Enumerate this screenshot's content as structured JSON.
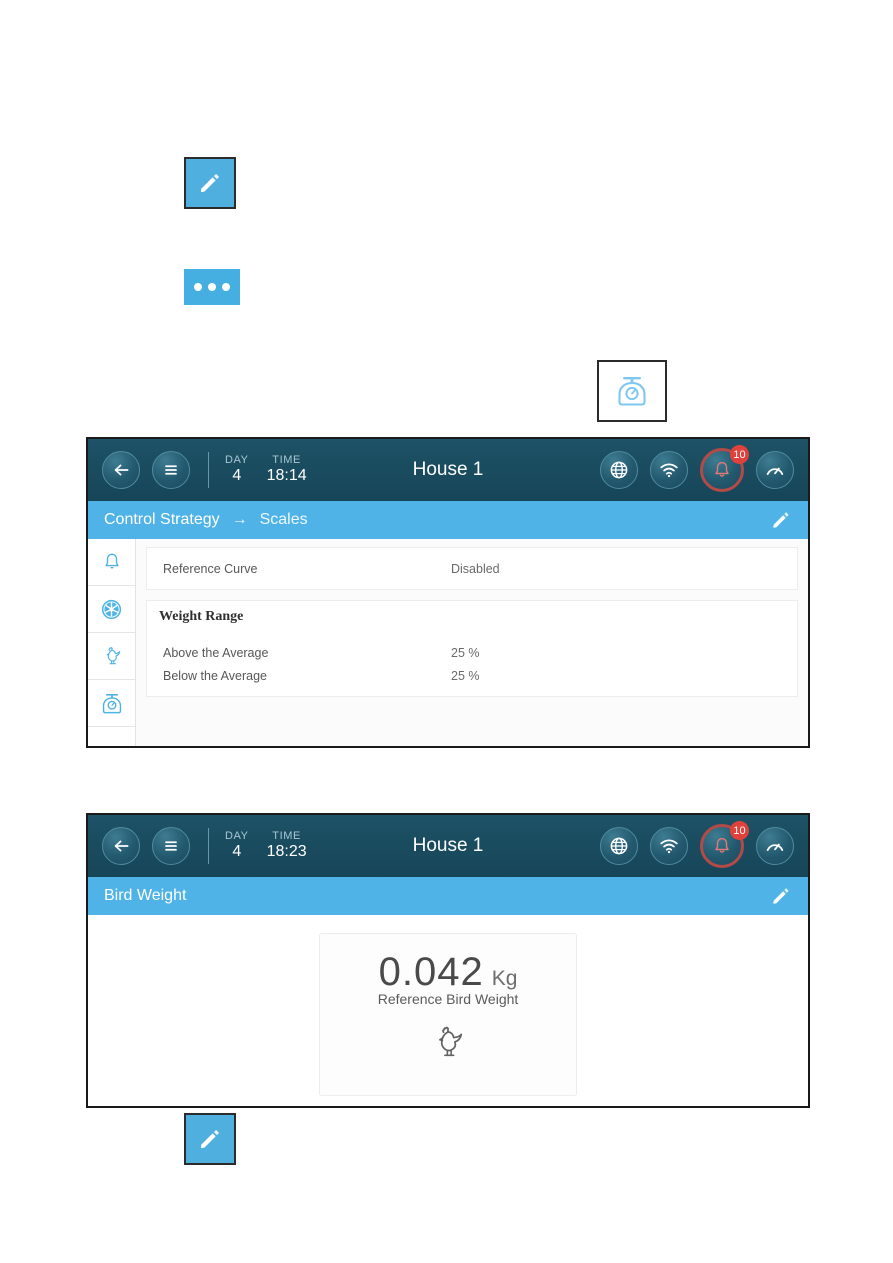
{
  "standalone_buttons": {
    "edit_pencil_top": {
      "icon": "pencil-icon",
      "label": ""
    },
    "more_dots": {
      "icon": "ellipsis-icon",
      "label": ""
    },
    "scales_menu": {
      "icon": "kitchen-scale-icon",
      "label": ""
    },
    "edit_pencil_bottom": {
      "icon": "pencil-icon",
      "label": ""
    }
  },
  "panel1": {
    "topbar": {
      "back_icon": "arrow-left-icon",
      "menu_icon": "hamburger-menu-icon",
      "day_label": "DAY",
      "day_value": "4",
      "time_label": "TIME",
      "time_value": "18:14",
      "title": "House 1",
      "globe_icon": "globe-icon",
      "wifi_icon": "wifi-icon",
      "bell_icon": "bell-icon",
      "bell_badge": "10",
      "gauge_icon": "gauge-icon"
    },
    "breadcrumb": {
      "parent": "Control Strategy",
      "arrow": "→",
      "current": "Scales",
      "edit_icon": "pencil-icon"
    },
    "sidebar": [
      {
        "icon": "bell-icon",
        "name": "alarms"
      },
      {
        "icon": "fan-icon",
        "name": "ventilation"
      },
      {
        "icon": "rooster-icon",
        "name": "birds"
      },
      {
        "icon": "kitchen-scale-icon",
        "name": "scales"
      }
    ],
    "rows": [
      {
        "label": "Reference Curve",
        "value": "Disabled"
      }
    ],
    "section": {
      "title": "Weight Range",
      "rows": [
        {
          "label": "Above the Average",
          "value": "25 %"
        },
        {
          "label": "Below the Average",
          "value": "25 %"
        }
      ]
    }
  },
  "panel2": {
    "topbar": {
      "back_icon": "arrow-left-icon",
      "menu_icon": "hamburger-menu-icon",
      "day_label": "DAY",
      "day_value": "4",
      "time_label": "TIME",
      "time_value": "18:23",
      "title": "House 1",
      "globe_icon": "globe-icon",
      "wifi_icon": "wifi-icon",
      "bell_icon": "bell-icon",
      "bell_badge": "10",
      "gauge_icon": "gauge-icon"
    },
    "breadcrumb": {
      "current": "Bird Weight",
      "edit_icon": "pencil-icon"
    },
    "weight_card": {
      "value": "0.042",
      "unit": "Kg",
      "caption": "Reference Bird Weight",
      "icon": "rooster-icon"
    }
  },
  "colors": {
    "header_dark": "#1a4d5e",
    "accent_blue": "#4fb3e8",
    "button_blue": "#45afe2",
    "alarm_red": "#e0413c",
    "icon_blue": "#4fb3e8"
  }
}
